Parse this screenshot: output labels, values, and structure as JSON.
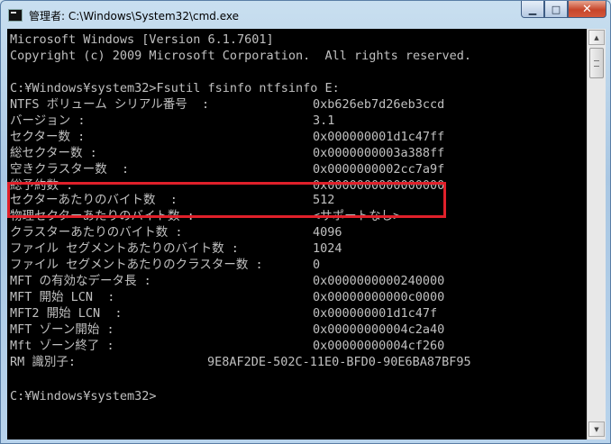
{
  "window": {
    "title": "管理者: C:\\Windows\\System32\\cmd.exe",
    "minimize_glyph": "▁",
    "maximize_glyph": "□",
    "close_glyph": "✕"
  },
  "console": {
    "lines": [
      "Microsoft Windows [Version 6.1.7601]",
      "Copyright (c) 2009 Microsoft Corporation.  All rights reserved.",
      "",
      "C:¥Windows¥system32>Fsutil fsinfo ntfsinfo E:"
    ],
    "rows": [
      {
        "label": "NTFS ボリューム シリアル番号  :",
        "value": "0xb626eb7d26eb3ccd"
      },
      {
        "label": "バージョン :",
        "value": "3.1"
      },
      {
        "label": "セクター数 :",
        "value": "0x000000001d1c47ff"
      },
      {
        "label": "総セクター数 :",
        "value": "0x0000000003a388ff"
      },
      {
        "label": "空きクラスター数  :",
        "value": "0x0000000002cc7a9f"
      },
      {
        "label": "総予約数 :",
        "value": "0x0000000000000000"
      },
      {
        "label": "セクターあたりのバイト数  :",
        "value": "512"
      },
      {
        "label": "物理セクターあたりのバイト数 :",
        "value": "<サポートなし>"
      },
      {
        "label": "クラスターあたりのバイト数 :",
        "value": "4096"
      },
      {
        "label": "ファイル セグメントあたりのバイト数 :",
        "value": "1024"
      },
      {
        "label": "ファイル セグメントあたりのクラスター数 :",
        "value": "0"
      },
      {
        "label": "MFT の有効なデータ長 :",
        "value": "0x0000000000240000"
      },
      {
        "label": "MFT 開始 LCN  :",
        "value": "0x00000000000c0000"
      },
      {
        "label": "MFT2 開始 LCN  :",
        "value": "0x000000001d1c47f"
      },
      {
        "label": "MFT ゾーン開始 :",
        "value": "0x00000000004c2a40"
      },
      {
        "label": "Mft ゾーン終了 :",
        "value": "0x00000000004cf260"
      }
    ],
    "rm_label": "RM 識別子:",
    "rm_value": "9E8AF2DE-502C-11E0-BFD0-90E6BA87BF95",
    "prompt": "C:¥Windows¥system32>"
  },
  "colors": {
    "console_text": "#c0c0c0",
    "console_bg": "#000000",
    "highlight_border": "#e0202a"
  }
}
